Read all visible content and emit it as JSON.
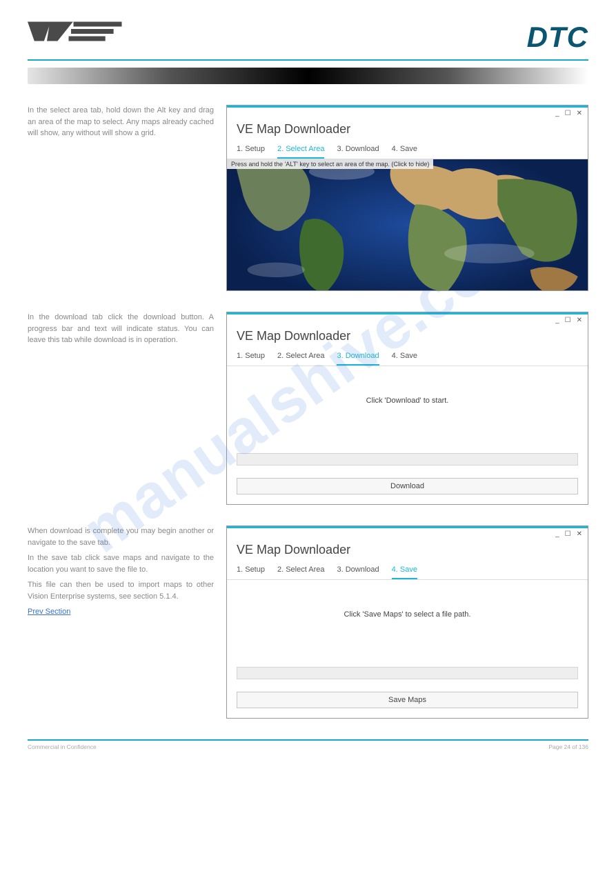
{
  "header": {
    "logo_left": "VE",
    "logo_right": "DTC"
  },
  "watermark": "manualshive.com",
  "sections": [
    {
      "left": {
        "paras": [
          "In the select area tab, hold down the Alt key and drag an area of the map to select. Any maps already cached will show, any without will show a grid."
        ]
      },
      "win": {
        "title": "VE Map Downloader",
        "tabs": [
          "1. Setup",
          "2. Select Area",
          "3. Download",
          "4. Save"
        ],
        "active_tab": 1,
        "hint": "Press and hold the 'ALT' key to select an area of the map. (Click to hide)",
        "variant": "map"
      }
    },
    {
      "left": {
        "paras": [
          "In the download tab click the download button. A progress bar and text will indicate status. You can leave this tab while download is in operation."
        ]
      },
      "win": {
        "title": "VE Map Downloader",
        "tabs": [
          "1. Setup",
          "2. Select Area",
          "3. Download",
          "4. Save"
        ],
        "active_tab": 2,
        "message": "Click 'Download' to start.",
        "button": "Download",
        "variant": "pane"
      }
    },
    {
      "left": {
        "paras": [
          "When download is complete you may begin another or navigate to the save tab.",
          "In the save tab click save maps and navigate to the location you want to save the file to.",
          "This file can then be used to import maps to other Vision Enterprise systems, see section 5.1.4."
        ],
        "link_text": "section 5.1.4",
        "prev_link": "Prev Section"
      },
      "win": {
        "title": "VE Map Downloader",
        "tabs": [
          "1. Setup",
          "2. Select Area",
          "3. Download",
          "4. Save"
        ],
        "active_tab": 3,
        "message": "Click 'Save Maps' to select a file path.",
        "button": "Save Maps",
        "variant": "pane"
      }
    }
  ],
  "footer": {
    "left": "Commercial in Confidence",
    "right": "Page 24 of 136"
  }
}
